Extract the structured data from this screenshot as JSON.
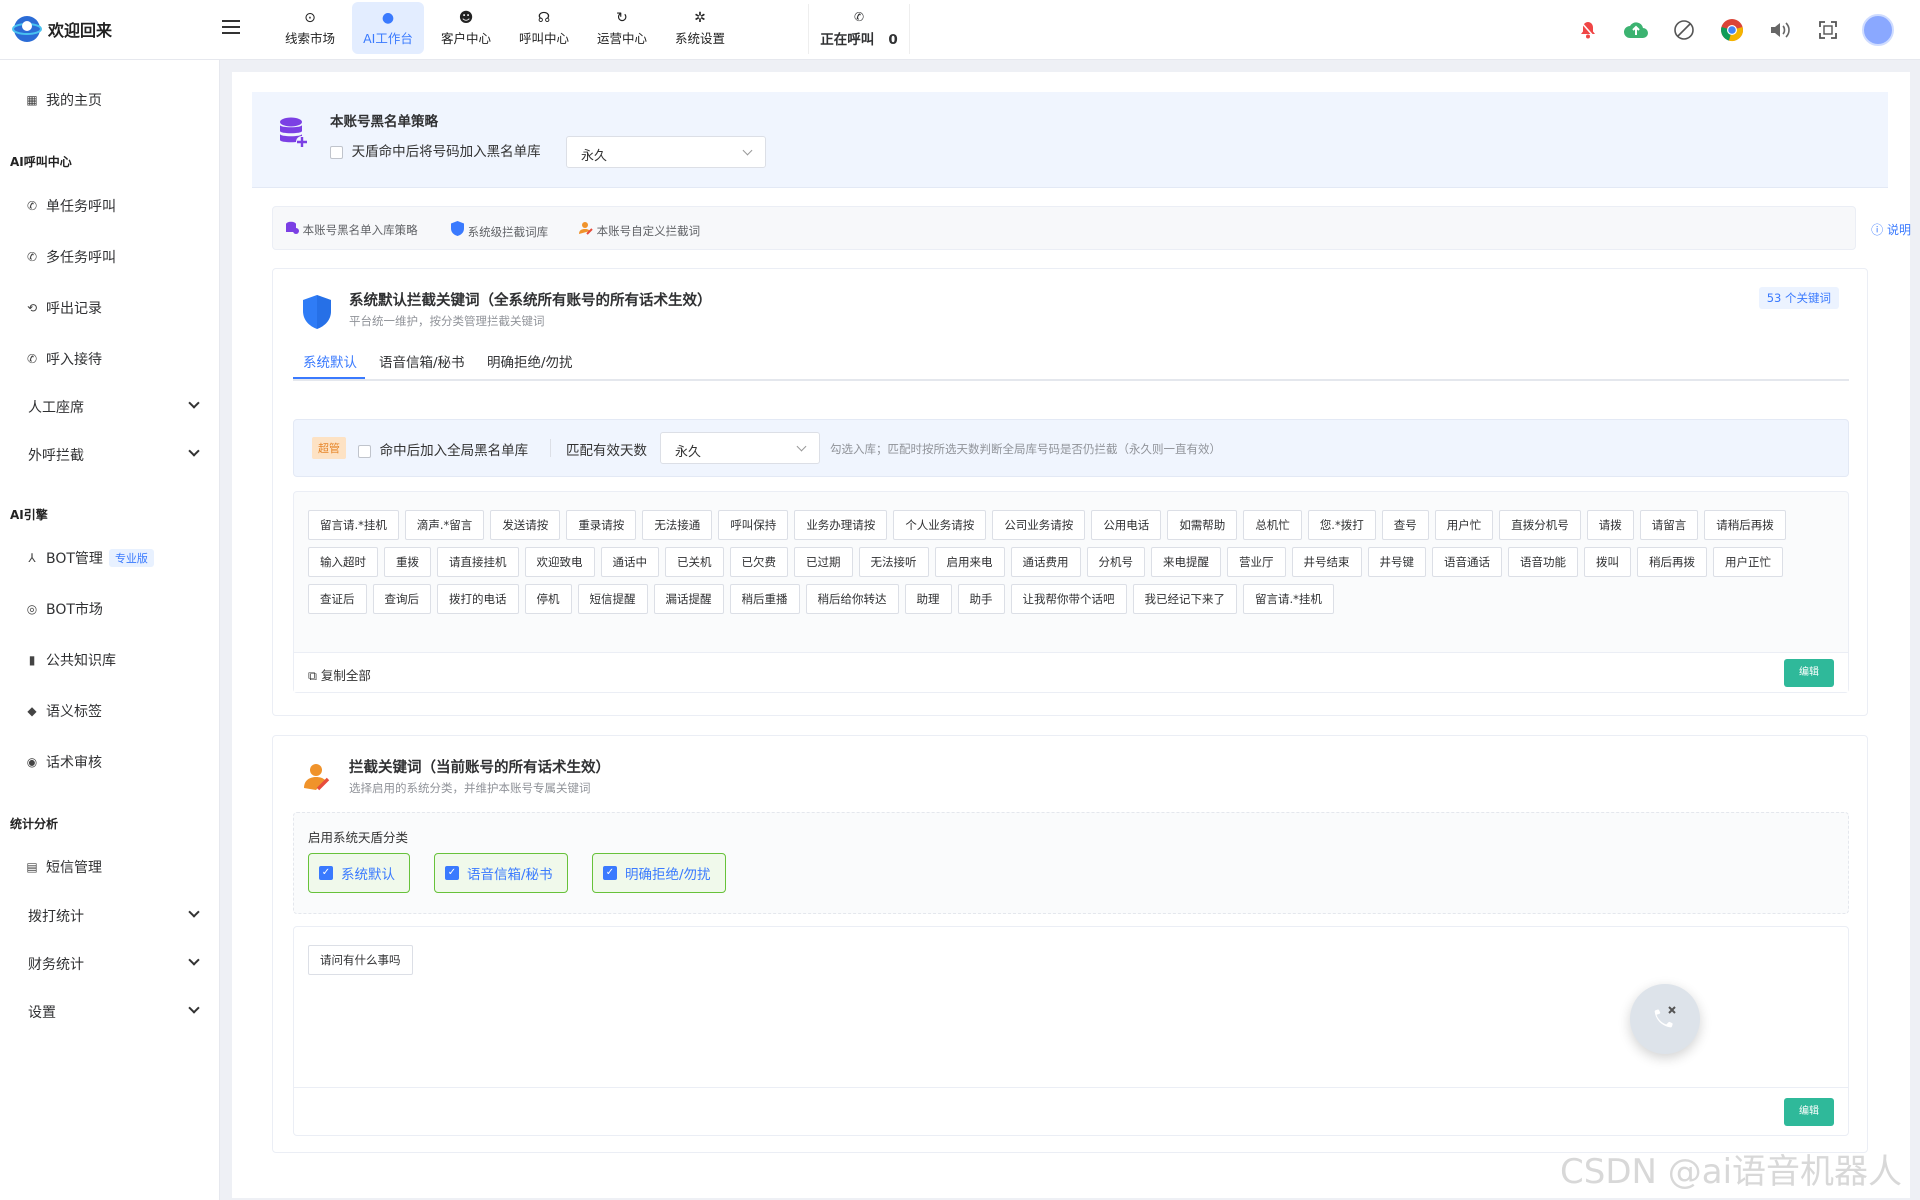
{
  "app": {
    "brand": "欢迎回来"
  },
  "topnav": {
    "items": [
      {
        "label": "线索市场",
        "icon": "compass-icon"
      },
      {
        "label": "AI工作台",
        "icon": "ai-icon",
        "active": true
      },
      {
        "label": "客户中心",
        "icon": "customers-icon"
      },
      {
        "label": "呼叫中心",
        "icon": "headset-icon"
      },
      {
        "label": "运营中心",
        "icon": "cycle-icon"
      },
      {
        "label": "系统设置",
        "icon": "gear-icon"
      }
    ],
    "calling_label": "正在呼叫",
    "calling_count": "0"
  },
  "sidebar": {
    "home": "我的主页",
    "sec_ai_call": "AI呼叫中心",
    "single_call": "单任务呼叫",
    "multi_call": "多任务呼叫",
    "outbound_records": "呼出记录",
    "inbound": "呼入接待",
    "agents": "人工座席",
    "outbound_block": "外呼拦截",
    "sec_ai_engine": "AI引擎",
    "bot_manage": "BOT管理",
    "bot_badge": "专业版",
    "bot_market": "BOT市场",
    "knowledge": "公共知识库",
    "semantic_tags": "语义标签",
    "script_review": "话术审核",
    "sec_stats": "统计分析",
    "sms": "短信管理",
    "dial_stats": "拨打统计",
    "finance_stats": "财务统计",
    "settings": "设置"
  },
  "blacklist": {
    "title": "本账号黑名单策略",
    "checkbox_label": "天盾命中后将号码加入黑名单库",
    "duration": "永久"
  },
  "subtabs": {
    "t1": "本账号黑名单入库策略",
    "t2": "系统级拦截词库",
    "t3": "本账号自定义拦截词",
    "help": "说明"
  },
  "system_card": {
    "title": "系统默认拦截关键词（全系统所有账号的所有话术生效）",
    "subtitle": "平台统一维护，按分类管理拦截关键词",
    "count": "53 个关键词",
    "tabs": [
      "系统默认",
      "语音信箱/秘书",
      "明确拒绝/勿扰"
    ],
    "admin_badge": "超管",
    "global_checkbox": "命中后加入全局黑名单库",
    "days_label": "匹配有效天数",
    "days_value": "永久",
    "hint": "勾选入库；匹配时按所选天数判断全局库号码是否仍拦截（永久则一直有效）",
    "keywords": [
      "留言请.*挂机",
      "滴声.*留言",
      "发送请按",
      "重录请按",
      "无法接通",
      "呼叫保持",
      "业务办理请按",
      "个人业务请按",
      "公司业务请按",
      "公用电话",
      "如需帮助",
      "总机忙",
      "您.*拨打",
      "查号",
      "用户忙",
      "直拨分机号",
      "请拨",
      "请留言",
      "请稍后再拨",
      "输入超时",
      "重拨",
      "请直接挂机",
      "欢迎致电",
      "通话中",
      "已关机",
      "已欠费",
      "已过期",
      "无法接听",
      "启用来电",
      "通话费用",
      "分机号",
      "来电提醒",
      "营业厅",
      "井号结束",
      "井号键",
      "语音通话",
      "语音功能",
      "拨叫",
      "稍后再拨",
      "用户正忙",
      "查证后",
      "查询后",
      "拨打的电话",
      "停机",
      "短信提醒",
      "漏话提醒",
      "稍后重播",
      "稍后给你转达",
      "助理",
      "助手",
      "让我帮你带个话吧",
      "我已经记下来了",
      "留言请.*挂机"
    ],
    "copy_all": "复制全部",
    "edit": "编辑"
  },
  "account_card": {
    "title": "拦截关键词（当前账号的所有话术生效）",
    "subtitle": "选择启用的系统分类，并维护本账号专属关键词",
    "enable_label": "启用系统天盾分类",
    "categories": [
      "系统默认",
      "语音信箱/秘书",
      "明确拒绝/勿扰"
    ],
    "keywords": [
      "请问有什么事吗"
    ],
    "edit": "编辑"
  },
  "watermark": "CSDN @ai语音机器人",
  "colors": {
    "accent": "#3a7afe",
    "edit_green": "#2fb99a",
    "check_border": "#67c23a"
  }
}
